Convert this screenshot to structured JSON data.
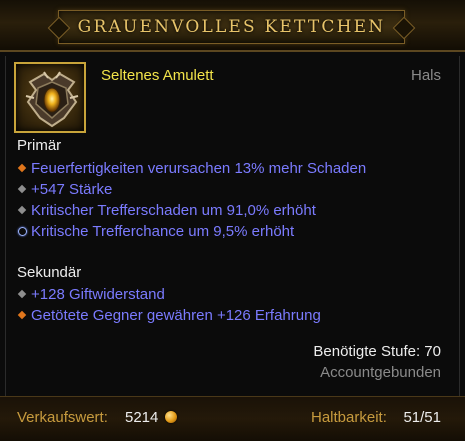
{
  "item": {
    "name": "GRAUENVOLLES KETTCHEN",
    "rarity": "Seltenes Amulett",
    "slot": "Hals",
    "icon": "amulet-icon"
  },
  "primary": {
    "label": "Primär",
    "stats": [
      {
        "text": "Feuerfertigkeiten verursachen 13% mehr Schaden",
        "bullet": "orange-diamond"
      },
      {
        "text": "+547 Stärke",
        "bullet": "gray-diamond"
      },
      {
        "text": "Kritischer Trefferschaden um 91,0% erhöht",
        "bullet": "gray-diamond"
      },
      {
        "text": "Kritische Trefferchance um 9,5% erhöht",
        "bullet": "blue-ring"
      }
    ]
  },
  "secondary": {
    "label": "Sekundär",
    "stats": [
      {
        "text": "+128 Giftwiderstand",
        "bullet": "gray-diamond"
      },
      {
        "text": "Getötete Gegner gewähren +126 Erfahrung",
        "bullet": "orange-diamond"
      }
    ]
  },
  "requirements": {
    "level_text": "Benötigte Stufe: 70",
    "bound_text": "Accountgebunden"
  },
  "footer": {
    "sell_label": "Verkaufswert:",
    "sell_value": "5214",
    "durability_label": "Haltbarkeit:",
    "durability_value": "51/51"
  },
  "colors": {
    "title_gold": "#e8c46a",
    "rarity_yellow": "#f2e44a",
    "stat_blue": "#7b7bff",
    "label_gold": "#c79b3e",
    "bullet_orange": "#e0761c",
    "bullet_gray": "#8e8e8e"
  }
}
